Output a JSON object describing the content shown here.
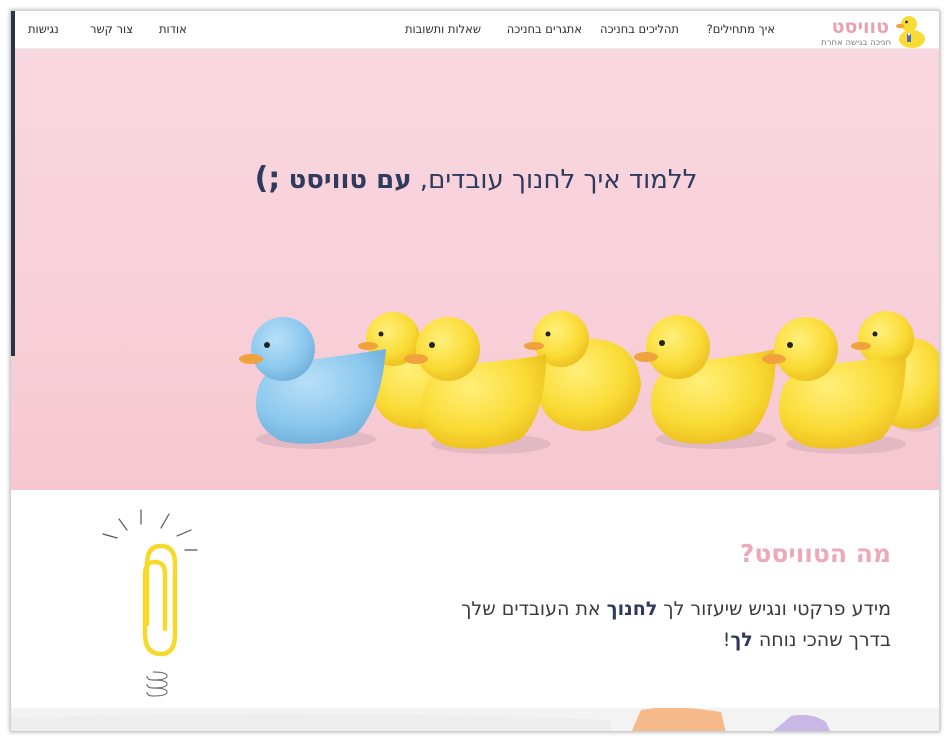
{
  "nav": {
    "logo": {
      "name": "טוויסט",
      "tagline": "חניכה בגישה אחרת"
    },
    "items": [
      {
        "label": "איך מתחילים?"
      },
      {
        "label": "תהליכים בחניכה"
      },
      {
        "label": "אתגרים בחניכה"
      },
      {
        "label": "שאלות ותשובות"
      },
      {
        "label": "אודות"
      },
      {
        "label": "צור קשר"
      },
      {
        "label": "נגישות"
      }
    ]
  },
  "hero": {
    "title_start": "ללמוד איך לחנוך עובדים, ",
    "title_bold": "עם טוויסט",
    "title_wink": ";)"
  },
  "twist": {
    "title": "מה הטוויסט?",
    "line1_start": "מידע פרקטי ונגיש שיעזור לך ",
    "line1_bold": "לחנוך",
    "line1_end": " את העובדים שלך",
    "line2_start": "בדרך שהכי נוחה ",
    "line2_bold": "לך",
    "line2_end": "!"
  },
  "colors": {
    "hero_bg": "#f8d0d9",
    "accent_pink": "#ecaab9",
    "title_navy": "#2e3a5e",
    "duck_yellow": "#fadb35",
    "duck_blue": "#8cc8ee"
  }
}
